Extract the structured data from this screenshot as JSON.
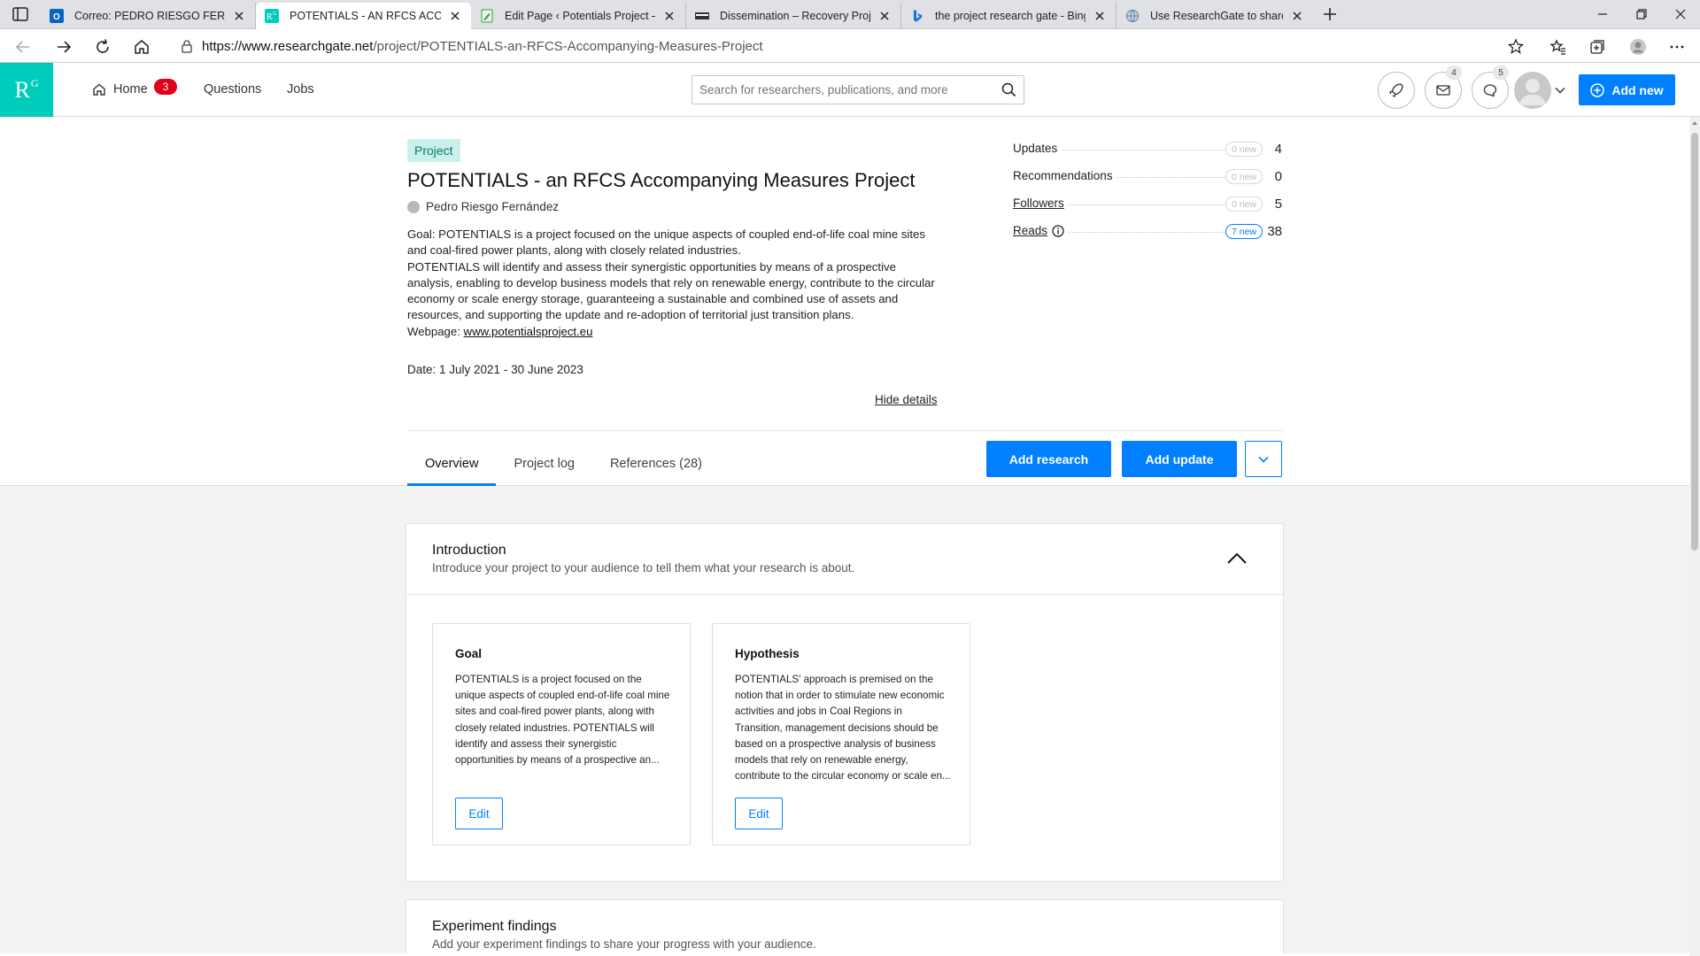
{
  "browser": {
    "tabs": [
      {
        "title": "Correo: PEDRO RIESGO FERNAN",
        "icon": "outlook-icon",
        "color": "#0a64c8"
      },
      {
        "title": "POTENTIALS - AN RFCS ACCOMI",
        "icon": "researchgate-icon",
        "color": "#00ccbb"
      },
      {
        "title": "Edit Page ‹ Potentials Project — V",
        "icon": "edit-page-icon",
        "color": "#3b9c3b"
      },
      {
        "title": "Dissemination – Recovery Projec",
        "icon": "recovery-icon",
        "color": "#333333"
      },
      {
        "title": "the project research gate - Bing",
        "icon": "bing-icon",
        "color": "#1b6fe0"
      },
      {
        "title": "Use ResearchGate to share resea",
        "icon": "globe-icon",
        "color": "#5f7fa3"
      }
    ],
    "active_tab": 1,
    "url": {
      "host": "https://www.researchgate.net",
      "path": "/project/POTENTIALS-an-RFCS-Accompanying-Measures-Project"
    }
  },
  "rg": {
    "logo": "R",
    "logo_sup": "G",
    "nav": {
      "home": "Home",
      "home_badge": "3",
      "questions": "Questions",
      "jobs": "Jobs"
    },
    "search_placeholder": "Search for researchers, publications, and more",
    "messages_badge": "4",
    "questions_badge": "5",
    "add_new": "Add new",
    "accent": "#0080ff",
    "brand": "#00ccbb"
  },
  "project": {
    "pill": "Project",
    "title": "POTENTIALS - an RFCS Accompanying Measures Project",
    "author": "Pedro Riesgo Fernández",
    "goal_1": "Goal: POTENTIALS is a project focused on the unique aspects of coupled end-of-life coal mine sites and coal-fired power plants, along with closely related industries.",
    "goal_2": "POTENTIALS will identify and assess their synergistic opportunities by means of a prospective analysis, enabling to develop business models that rely on renewable energy, contribute to the circular economy or scale energy storage, guaranteeing a sustainable and combined use of assets and resources, and supporting the update and re-adoption of territorial just transition plans.",
    "webpage_label": "Webpage: ",
    "webpage_link": "www.potentialsproject.eu",
    "date": "Date: 1 July 2021 - 30 June 2023",
    "hide_details": "Hide details",
    "stats": [
      {
        "label": "Updates",
        "new": "0 new",
        "value": "4",
        "underline": false,
        "hot": false
      },
      {
        "label": "Recommendations",
        "new": "0 new",
        "value": "0",
        "underline": false,
        "hot": false
      },
      {
        "label": "Followers",
        "new": "0 new",
        "value": "5",
        "underline": true,
        "hot": false
      },
      {
        "label": "Reads",
        "new": "7 new",
        "value": "38",
        "underline": true,
        "hot": true
      }
    ],
    "tabs": [
      "Overview",
      "Project log",
      "References (28)"
    ],
    "add_research": "Add research",
    "add_update": "Add update"
  },
  "intro": {
    "title": "Introduction",
    "subtitle": "Introduce your project to your audience to tell them what your research is about.",
    "goal": {
      "title": "Goal",
      "text": "POTENTIALS is a project focused on the unique aspects of coupled end-of-life coal mine sites and coal-fired power plants, along with closely related industries. POTENTIALS will identify and assess their synergistic opportunities by means of a prospective an...",
      "edit": "Edit"
    },
    "hypothesis": {
      "title": "Hypothesis",
      "text": "POTENTIALS' approach is premised on the notion that in order to stimulate new economic activities and jobs in Coal Regions in Transition, management decisions should be based on a prospective analysis of business models that rely on renewable energy, contribute to the circular economy or scale en...",
      "edit": "Edit"
    }
  },
  "findings": {
    "title": "Experiment findings",
    "subtitle": "Add your experiment findings to share your progress with your audience."
  }
}
